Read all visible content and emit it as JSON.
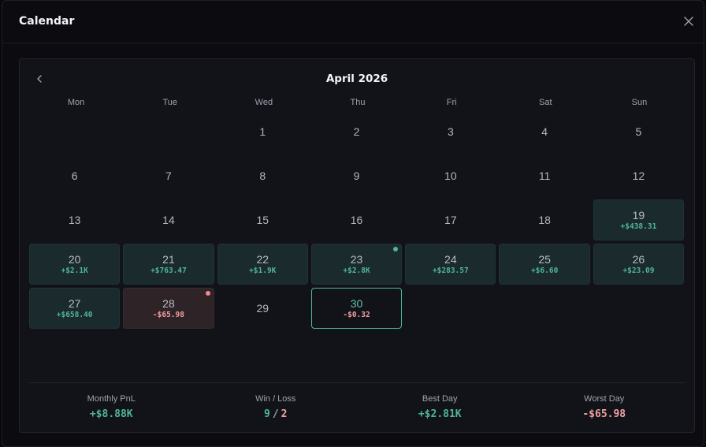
{
  "modal": {
    "title": "Calendar",
    "close_icon": "close-icon"
  },
  "calendar": {
    "month_title": "April 2026",
    "prev_icon": "chevron-left-icon",
    "weekdays": [
      "Mon",
      "Tue",
      "Wed",
      "Thu",
      "Fri",
      "Sat",
      "Sun"
    ],
    "leading_blanks": 2,
    "days": [
      {
        "day": "1",
        "pnl": "",
        "status": "none"
      },
      {
        "day": "2",
        "pnl": "",
        "status": "none"
      },
      {
        "day": "3",
        "pnl": "",
        "status": "none"
      },
      {
        "day": "4",
        "pnl": "",
        "status": "none"
      },
      {
        "day": "5",
        "pnl": "",
        "status": "none"
      },
      {
        "day": "6",
        "pnl": "",
        "status": "none"
      },
      {
        "day": "7",
        "pnl": "",
        "status": "none"
      },
      {
        "day": "8",
        "pnl": "",
        "status": "none"
      },
      {
        "day": "9",
        "pnl": "",
        "status": "none"
      },
      {
        "day": "10",
        "pnl": "",
        "status": "none"
      },
      {
        "day": "11",
        "pnl": "",
        "status": "none"
      },
      {
        "day": "12",
        "pnl": "",
        "status": "none"
      },
      {
        "day": "13",
        "pnl": "",
        "status": "none"
      },
      {
        "day": "14",
        "pnl": "",
        "status": "none"
      },
      {
        "day": "15",
        "pnl": "",
        "status": "none"
      },
      {
        "day": "16",
        "pnl": "",
        "status": "none"
      },
      {
        "day": "17",
        "pnl": "",
        "status": "none"
      },
      {
        "day": "18",
        "pnl": "",
        "status": "none"
      },
      {
        "day": "19",
        "pnl": "+$438.31",
        "status": "win"
      },
      {
        "day": "20",
        "pnl": "+$2.1K",
        "status": "win"
      },
      {
        "day": "21",
        "pnl": "+$763.47",
        "status": "win"
      },
      {
        "day": "22",
        "pnl": "+$1.9K",
        "status": "win"
      },
      {
        "day": "23",
        "pnl": "+$2.8K",
        "status": "win",
        "marker": "best"
      },
      {
        "day": "24",
        "pnl": "+$283.57",
        "status": "win"
      },
      {
        "day": "25",
        "pnl": "+$6.60",
        "status": "win"
      },
      {
        "day": "26",
        "pnl": "+$23.09",
        "status": "win"
      },
      {
        "day": "27",
        "pnl": "+$658.40",
        "status": "win"
      },
      {
        "day": "28",
        "pnl": "-$65.98",
        "status": "loss",
        "marker": "worst"
      },
      {
        "day": "29",
        "pnl": "",
        "status": "none"
      },
      {
        "day": "30",
        "pnl": "-$0.32",
        "status": "today"
      }
    ]
  },
  "stats": {
    "monthly_pnl": {
      "label": "Monthly PnL",
      "value": "+$8.88K"
    },
    "win_loss": {
      "label": "Win / Loss",
      "wins": "9",
      "separator": "/",
      "losses": "2"
    },
    "best_day": {
      "label": "Best Day",
      "value": "+$2.81K"
    },
    "worst_day": {
      "label": "Worst Day",
      "value": "-$65.98"
    }
  },
  "colors": {
    "win": "#4fb59a",
    "loss": "#f0a0a0",
    "win_cell_bg": "#1a2a2d",
    "loss_cell_bg": "#2e2326",
    "today_border": "#4fb5a5"
  }
}
